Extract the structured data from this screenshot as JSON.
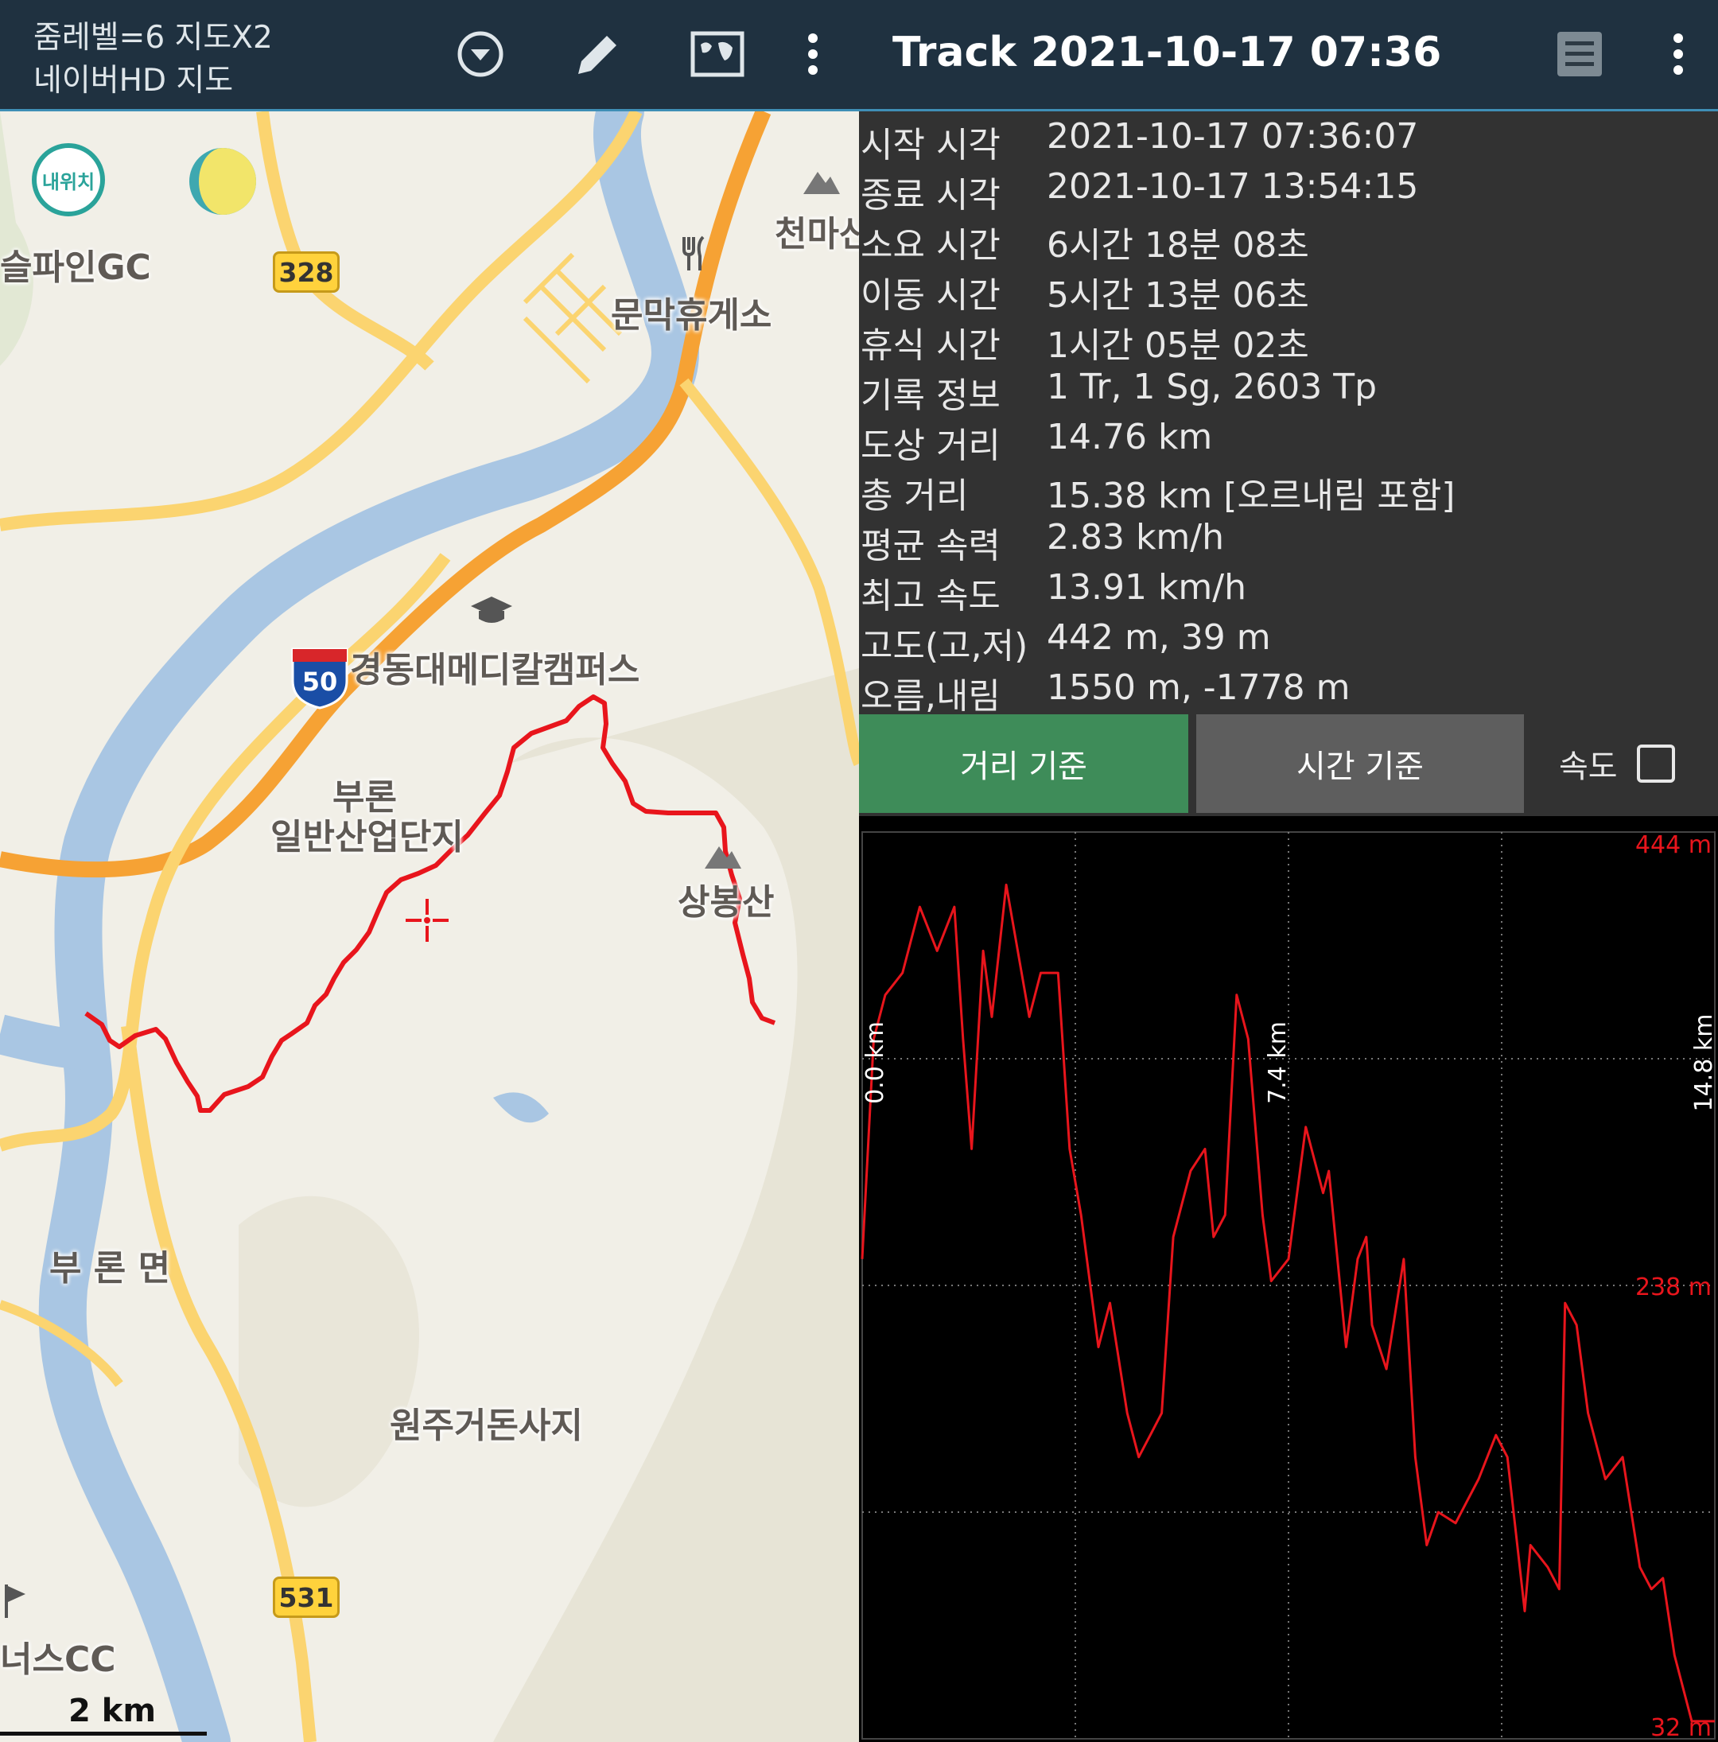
{
  "map_header": {
    "zoom_info": "줌레벨=6 지도X2",
    "map_source": "네이버HD 지도",
    "icons": [
      "chevron-down-circle-icon",
      "pencil-icon",
      "world-map-icon",
      "more-vert-icon"
    ]
  },
  "track_header": {
    "title": "Track 2021-10-17 07:36",
    "icons": [
      "list-icon",
      "more-vert-icon"
    ]
  },
  "map": {
    "my_location_label": "내위치",
    "labels": [
      "슬파인GC",
      "천마산",
      "문막휴게소",
      "경동대메디칼캠퍼스",
      "부론",
      "일반산업단지",
      "상봉산",
      "부 론 면",
      "원주거돈사지",
      "너스CC"
    ],
    "road_badges": [
      "328",
      "50",
      "531"
    ],
    "scale": "2 km",
    "colors": {
      "track": "#e8151c",
      "water": "#a9c6e3",
      "highway": "#f6a234",
      "road": "#fbd470"
    }
  },
  "stats": [
    {
      "label": "시작 시각",
      "value": "2021-10-17 07:36:07"
    },
    {
      "label": "종료 시각",
      "value": "2021-10-17 13:54:15"
    },
    {
      "label": "소요 시간",
      "value": "6시간 18분 08초"
    },
    {
      "label": "이동 시간",
      "value": "5시간 13분 06초"
    },
    {
      "label": "휴식 시간",
      "value": "1시간 05분 02초"
    },
    {
      "label": "기록 정보",
      "value": "1 Tr, 1 Sg, 2603 Tp"
    },
    {
      "label": "도상 거리",
      "value": "14.76 km"
    },
    {
      "label": "총 거리",
      "value": "15.38 km [오르내림 포함]"
    },
    {
      "label": "평균 속력",
      "value": "2.83 km/h"
    },
    {
      "label": "최고 속도",
      "value": "13.91 km/h"
    },
    {
      "label": "고도(고,저)",
      "value": "442 m, 39 m"
    },
    {
      "label": "오름,내림",
      "value": "1550 m, -1778 m"
    }
  ],
  "tabs": {
    "distance_label": "거리 기준",
    "time_label": "시간 기준",
    "speed_label": "속도",
    "speed_checked": false,
    "active": "distance"
  },
  "chart_data": {
    "type": "line",
    "xlabel": "",
    "ylabel": "",
    "x_tick_labels": [
      "0.0 km",
      "7.4 km",
      "14.8 km"
    ],
    "y_tick_labels": [
      "444 m",
      "238 m",
      "32 m"
    ],
    "xlim": [
      0,
      14.8
    ],
    "ylim": [
      32,
      444
    ],
    "grid": true,
    "line_color": "#e8151c",
    "series": [
      {
        "x": [
          0.0,
          0.2,
          0.4,
          0.7,
          1.0,
          1.3,
          1.6,
          1.75,
          1.9,
          2.1,
          2.25,
          2.5,
          2.9,
          3.1,
          3.4,
          3.6,
          3.8,
          3.95,
          4.1,
          4.3,
          4.6,
          4.8,
          5.0,
          5.2,
          5.4,
          5.7,
          5.95,
          6.1,
          6.3,
          6.5,
          6.7,
          6.95,
          7.1,
          7.4,
          7.7,
          8.0,
          8.1,
          8.4,
          8.6,
          8.75,
          8.85,
          9.1,
          9.4,
          9.6,
          9.8,
          10.0,
          10.3,
          10.5,
          10.7,
          11.0,
          11.2,
          11.5,
          11.6,
          11.9,
          12.1,
          12.2,
          12.4,
          12.6,
          12.9,
          13.2,
          13.5,
          13.7,
          13.9,
          14.1,
          14.4,
          14.8
        ],
        "y": [
          250,
          350,
          370,
          380,
          410,
          390,
          410,
          350,
          300,
          390,
          360,
          420,
          360,
          380,
          380,
          300,
          270,
          240,
          210,
          230,
          180,
          160,
          170,
          180,
          260,
          290,
          300,
          260,
          270,
          370,
          350,
          270,
          240,
          250,
          310,
          280,
          290,
          210,
          250,
          260,
          220,
          200,
          250,
          160,
          120,
          135,
          130,
          140,
          150,
          170,
          160,
          90,
          120,
          110,
          100,
          230,
          220,
          180,
          150,
          160,
          110,
          100,
          105,
          70,
          40,
          40
        ]
      }
    ]
  }
}
